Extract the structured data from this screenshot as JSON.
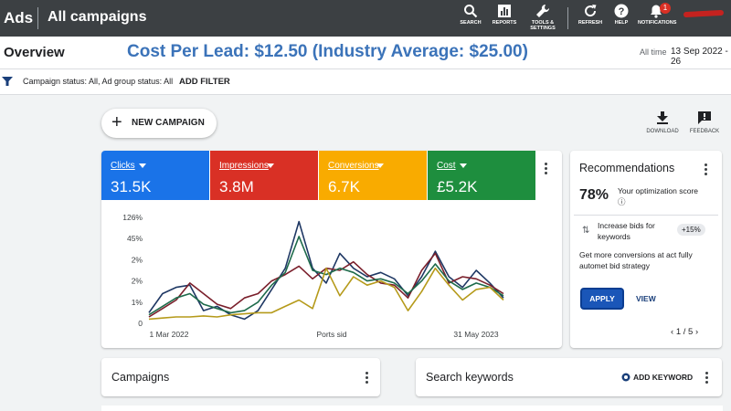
{
  "topbar": {
    "brand": "Ads",
    "title": "All campaigns",
    "actions": [
      {
        "label": "SEARCH",
        "icon": "search-icon"
      },
      {
        "label": "REPORTS",
        "icon": "reports-icon"
      },
      {
        "label": "TOOLS & SETTINGS",
        "icon": "wrench-icon"
      },
      {
        "label": "REFRESH",
        "icon": "refresh-icon"
      },
      {
        "label": "HELP",
        "icon": "help-icon"
      },
      {
        "label": "NOTIFICATIONS",
        "icon": "bell-icon"
      }
    ],
    "notification_count": "1"
  },
  "overview": {
    "title": "Overview",
    "headline": "Cost Per Lead: $12.50 (Industry Average: $25.00)",
    "all_time": "All time",
    "date_range": "13 Sep 2022 - 26"
  },
  "filters": {
    "status_text": "Campaign status: All, Ad group status: All",
    "add_filter": "ADD FILTER"
  },
  "new_campaign_label": "NEW CAMPAIGN",
  "side_actions": {
    "download": "DOWNLOAD",
    "feedback": "FEEDBACK"
  },
  "metrics": [
    {
      "name": "Clicks",
      "value": "31.5K",
      "color": "#1a73e8"
    },
    {
      "name": "Impressions",
      "value": "3.8M",
      "color": "#d93025"
    },
    {
      "name": "Conversions",
      "value": "6.7K",
      "color": "#f9ab00"
    },
    {
      "name": "Cost",
      "value": "£5.2K",
      "color": "#1e8e3e"
    }
  ],
  "chart_data": {
    "type": "line",
    "y_tick_labels": [
      "126%",
      "45%",
      "2%",
      "2%",
      "1%",
      "0"
    ],
    "x_tick_labels": [
      "1 Mar 2022",
      "Ports sid",
      "31 May 2023"
    ],
    "series": [
      {
        "color": "#1f3864",
        "values": [
          0.5,
          1.4,
          1.7,
          1.8,
          0.6,
          0.8,
          0.4,
          0.2,
          0.6,
          1.6,
          2.6,
          4.8,
          2.6,
          1.9,
          3.3,
          2.6,
          2.2,
          2.4,
          2.1,
          1.3,
          2.2,
          3.4,
          2.2,
          1.7,
          2.5,
          1.9,
          1.2
        ]
      },
      {
        "color": "#7a1f2b",
        "values": [
          0.3,
          0.7,
          1.1,
          1.9,
          1.4,
          0.9,
          0.7,
          1.2,
          1.4,
          2.0,
          2.3,
          2.7,
          2.1,
          2.6,
          2.5,
          2.9,
          2.3,
          1.9,
          1.8,
          1.2,
          2.5,
          3.3,
          1.9,
          2.2,
          2.1,
          1.8,
          1.4
        ]
      },
      {
        "color": "#1e6b4b",
        "values": [
          0.4,
          0.8,
          1.2,
          1.4,
          0.9,
          0.7,
          0.5,
          0.6,
          1.0,
          1.8,
          2.4,
          4.1,
          2.5,
          2.3,
          2.6,
          2.4,
          2.0,
          2.1,
          1.9,
          1.4,
          2.0,
          2.8,
          2.0,
          1.6,
          1.9,
          1.7,
          1.3
        ]
      },
      {
        "color": "#b59a1a",
        "values": [
          0.2,
          0.25,
          0.3,
          0.3,
          0.35,
          0.3,
          0.4,
          0.45,
          0.5,
          0.5,
          0.8,
          1.1,
          0.7,
          2.6,
          1.3,
          2.2,
          1.8,
          2.0,
          1.7,
          0.6,
          1.5,
          2.6,
          1.8,
          1.1,
          1.6,
          1.7,
          1.1
        ]
      }
    ],
    "ylim": [
      0,
      5
    ]
  },
  "recommendations": {
    "title": "Recommendations",
    "score": "78%",
    "score_label": "Your optimization score",
    "item_text": "Increase bids for keywords",
    "item_badge": "+15%",
    "description": "Get more conversions at act fully automet bid strategy",
    "apply": "APPLY",
    "view": "VIEW",
    "pager": "1 / 5"
  },
  "bottom": {
    "campaigns": "Campaigns",
    "search_keywords": "Search keywords",
    "add_keyword": "ADD KEYWORD"
  }
}
